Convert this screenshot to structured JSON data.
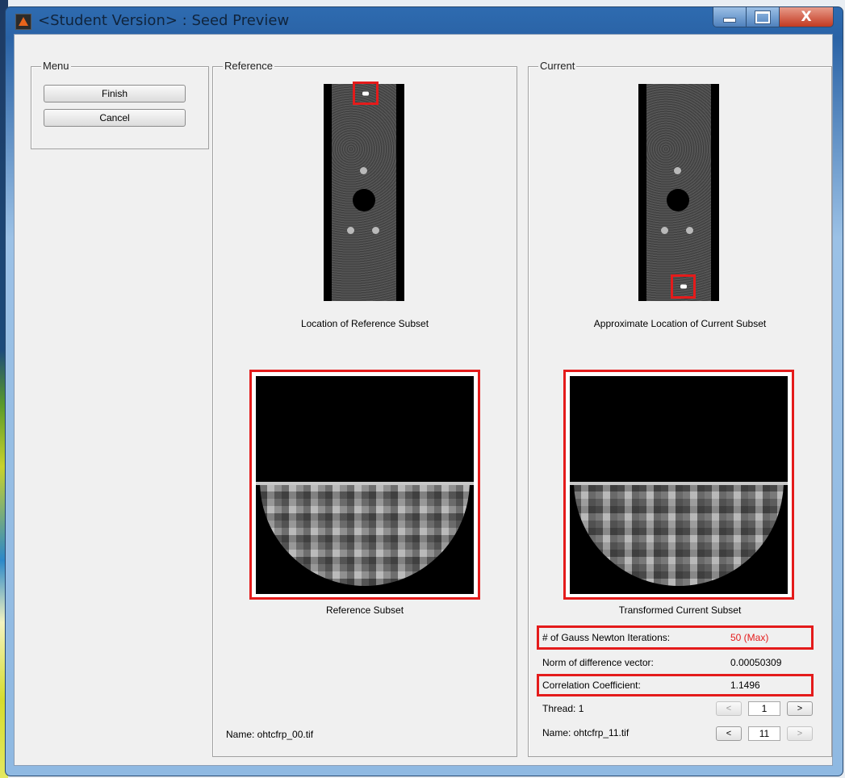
{
  "window": {
    "title": "<Student Version> : Seed Preview",
    "close_glyph": "X",
    "min_icon": "minimize-icon",
    "max_icon": "maximize-icon"
  },
  "menu": {
    "title": "Menu",
    "finish_label": "Finish",
    "cancel_label": "Cancel"
  },
  "reference": {
    "title": "Reference",
    "location_caption": "Location of Reference Subset",
    "subset_caption": "Reference Subset",
    "name_text": "Name: ohtcfrp_00.tif"
  },
  "current": {
    "title": "Current",
    "location_caption": "Approximate Location of Current Subset",
    "subset_caption": "Transformed Current Subset",
    "iterations_label": "# of Gauss Newton Iterations:",
    "iterations_value": "50 (Max)",
    "norm_label": "Norm of difference vector:",
    "norm_value": "0.00050309",
    "corr_label": "Correlation Coefficient:",
    "corr_value": "1.1496",
    "thread_label": "Thread: 1",
    "thread_value": "1",
    "name_label": "Name: ohtcfrp_11.tif",
    "image_index": "11",
    "prev_glyph": "<",
    "next_glyph": ">"
  },
  "colors": {
    "highlight_red": "#e41b1b",
    "iterations_value_color": "#e41b1b"
  }
}
